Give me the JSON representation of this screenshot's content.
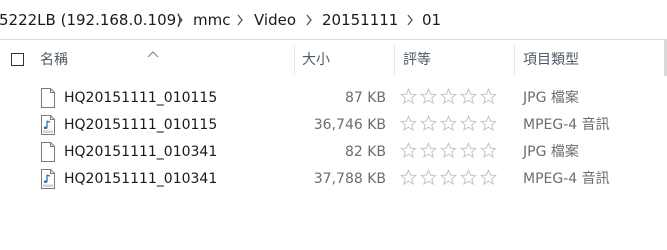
{
  "breadcrumb": {
    "items": [
      "5222LB (192.168.0.109)",
      "mmc",
      "Video",
      "20151111",
      "01"
    ]
  },
  "columns": {
    "name": "名稱",
    "size": "大小",
    "rating": "評等",
    "type": "項目類型"
  },
  "files": [
    {
      "name": "HQ20151111_010115",
      "size": "87 KB",
      "type": "JPG 檔案",
      "icon": "generic-file-icon",
      "rating": 0
    },
    {
      "name": "HQ20151111_010115",
      "size": "36,746 KB",
      "type": "MPEG-4 音訊",
      "icon": "audio-file-icon",
      "rating": 0
    },
    {
      "name": "HQ20151111_010341",
      "size": "82 KB",
      "type": "JPG 檔案",
      "icon": "generic-file-icon",
      "rating": 0
    },
    {
      "name": "HQ20151111_010341",
      "size": "37,788 KB",
      "type": "MPEG-4 音訊",
      "icon": "audio-file-icon",
      "rating": 0
    }
  ],
  "colors": {
    "text": "#1a1a1a",
    "header_text": "#4d5a68",
    "muted_text": "#6d6d6d",
    "star_empty": "#c4c4c4",
    "audio_icon_accent": "#2a6fbd"
  }
}
